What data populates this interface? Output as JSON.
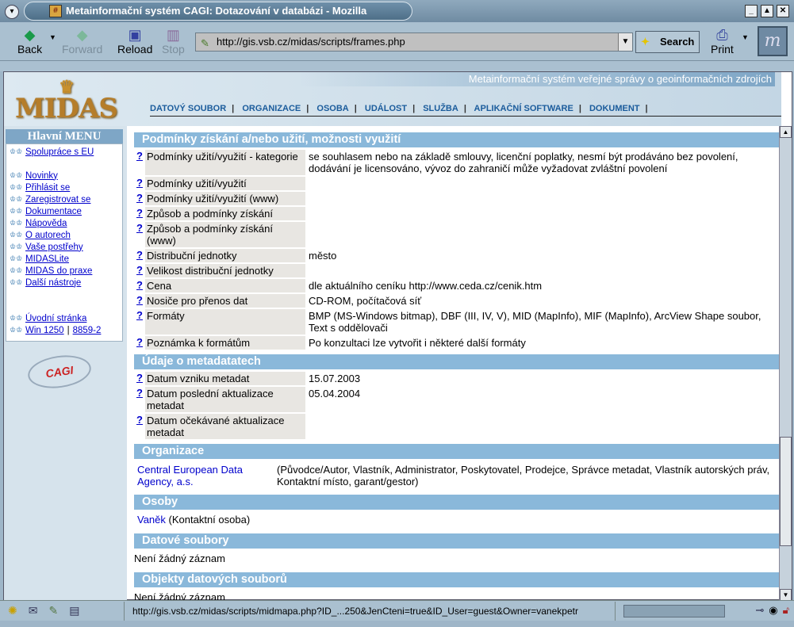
{
  "window": {
    "title": "Metainformační systém CAGI: Dotazování v databázi - Mozilla"
  },
  "toolbar": {
    "back": "Back",
    "forward": "Forward",
    "reload": "Reload",
    "stop": "Stop",
    "url": "http://gis.vsb.cz/midas/scripts/frames.php",
    "search": "Search",
    "print": "Print"
  },
  "header": {
    "logo": "MIDAS",
    "tagline": "Metainformační systém veřejné správy o geoinformačních zdrojích",
    "nav": [
      "DATOVÝ SOUBOR",
      "ORGANIZACE",
      "OSOBA",
      "UDÁLOST",
      "SLUŽBA",
      "APLIKAČNÍ SOFTWARE",
      "DOKUMENT"
    ]
  },
  "sidebar": {
    "title": "Hlavní MENU",
    "items": [
      "Spolupráce s EU",
      "Novinky",
      "Přihlásit se",
      "Zaregistrovat se",
      "Dokumentace",
      "Nápověda",
      "O autorech",
      "Vaše postřehy",
      "MIDASLite",
      "MIDAS do praxe",
      "Další nástroje",
      "Úvodní stránka",
      "Win 1250",
      "8859-2"
    ],
    "partner_logo": "CAGI"
  },
  "main": {
    "help": "?",
    "s1": {
      "title": "Podmínky získání a/nebo užití, možnosti využití",
      "rows": [
        {
          "label": "Podmínky užití/využití - kategorie",
          "value": "se souhlasem nebo na základě smlouvy, licenční poplatky, nesmí být prodáváno bez povolení, dodávání je licensováno, vývoz do zahraničí může vyžadovat zvláštní povolení"
        },
        {
          "label": "Podmínky užití/využití",
          "value": ""
        },
        {
          "label": "Podmínky užití/využití (www)",
          "value": ""
        },
        {
          "label": "Způsob a podmínky získání",
          "value": ""
        },
        {
          "label": "Způsob a podmínky získání (www)",
          "value": ""
        },
        {
          "label": "Distribuční jednotky",
          "value": "město"
        },
        {
          "label": "Velikost distribuční jednotky",
          "value": ""
        },
        {
          "label": "Cena",
          "value": "dle aktuálního ceníku http://www.ceda.cz/cenik.htm"
        },
        {
          "label": "Nosiče pro přenos dat",
          "value": "CD-ROM, počítačová síť"
        },
        {
          "label": "Formáty",
          "value": "BMP (MS-Windows bitmap), DBF (III, IV, V), MID (MapInfo), MIF (MapInfo), ArcView Shape soubor, Text s oddělovači"
        },
        {
          "label": "Poznámka k formátům",
          "value": "Po konzultaci lze vytvořit i některé další formáty"
        }
      ]
    },
    "s2": {
      "title": "Údaje o metadatatech",
      "rows": [
        {
          "label": "Datum vzniku metadat",
          "value": "15.07.2003"
        },
        {
          "label": "Datum poslední aktualizace metadat",
          "value": "05.04.2004"
        },
        {
          "label": "Datum očekávané aktualizace metadat",
          "value": ""
        }
      ]
    },
    "s3": {
      "title": "Organizace",
      "org": "Central European Data Agency, a.s.",
      "roles": "(Původce/Autor, Vlastník, Administrator, Poskytovatel, Prodejce, Správce metadat, Vlastník autorských práv, Kontaktní místo, garant/gestor)"
    },
    "s4": {
      "title": "Osoby",
      "person": "Vaněk",
      "role": "(Kontaktní osoba)"
    },
    "s5": {
      "title": "Datové soubory",
      "text": "Není žádný záznam"
    },
    "s6": {
      "title": "Objekty datových souborů",
      "text": "Není žádný záznam"
    }
  },
  "status": {
    "url": "http://gis.vsb.cz/midas/scripts/midmapa.php?ID_...250&JenCteni=true&ID_User=guest&Owner=vanekpetr"
  }
}
